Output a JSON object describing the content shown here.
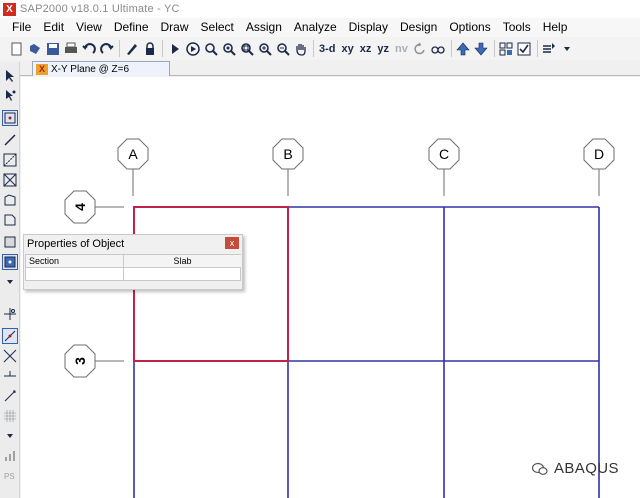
{
  "window": {
    "app_icon": "X",
    "title": "SAP2000 v18.0.1 Ultimate  - YC"
  },
  "menu": [
    "File",
    "Edit",
    "View",
    "Define",
    "Draw",
    "Select",
    "Assign",
    "Analyze",
    "Display",
    "Design",
    "Options",
    "Tools",
    "Help"
  ],
  "toolbar": {
    "view_3d": "3-d",
    "view_xy": "xy",
    "view_xz": "xz",
    "view_yz": "yz",
    "view_nv": "nv"
  },
  "tab": {
    "label": "X-Y Plane @ Z=6"
  },
  "grid": {
    "columns": [
      "A",
      "B",
      "C",
      "D"
    ],
    "rows": [
      "4",
      "3"
    ],
    "colors": {
      "frame": "#3230a8",
      "selected": "#c0204a",
      "gridline": "#6e6e6e"
    }
  },
  "properties": {
    "title": "Properties of Object",
    "close_symbol": "x",
    "header_left": "Section",
    "header_right": "Slab"
  },
  "watermark": {
    "text": "ABAQUS"
  }
}
